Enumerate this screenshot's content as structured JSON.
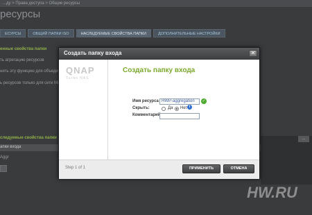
{
  "background": {
    "breadcrumb": "…ду > Права доступа > Общие ресурсы",
    "page_title": "ресурсы",
    "tabs": [
      {
        "label": "ЕСУРСЫ"
      },
      {
        "label": "ОБЩИЙ ПАПКИ ISO"
      },
      {
        "label": "НАСЛЕДУЕМЫЕ СВОЙСТВА ПАПКИ"
      },
      {
        "label": "ДОПОЛНИТЕЛЬНЫЕ НАСТРОЙКИ"
      }
    ],
    "section1_title": "енные свойства папки",
    "line1": "ть агрегацию ресурсов",
    "line2": "нить эту функцию для объединен",
    "line3": "ь ресурсов только для сети Mi",
    "section2_title": "следуемые свойства папки",
    "table_header": "апки входа",
    "row_text": "Aggr",
    "corner_button": "..."
  },
  "modal": {
    "title": "Создать папку входа",
    "close_symbol": "✕",
    "logo": "QNAP",
    "logo_sub": "Turbo NAS",
    "wizard_title": "Создать папку входа",
    "fields": {
      "resource_label": "Имя ресурса",
      "resource_value": "HWP-aggregation",
      "hide_label": "Скрыть:",
      "hide_yes": "Да",
      "hide_no": "Нет",
      "comment_label": "Комментарий:",
      "comment_value": ""
    },
    "step_text": "Step 1 of 1",
    "apply_label": "ПРИМЕНИТЬ",
    "cancel_label": "ОТМЕНА"
  },
  "watermark": "HW.RU"
}
